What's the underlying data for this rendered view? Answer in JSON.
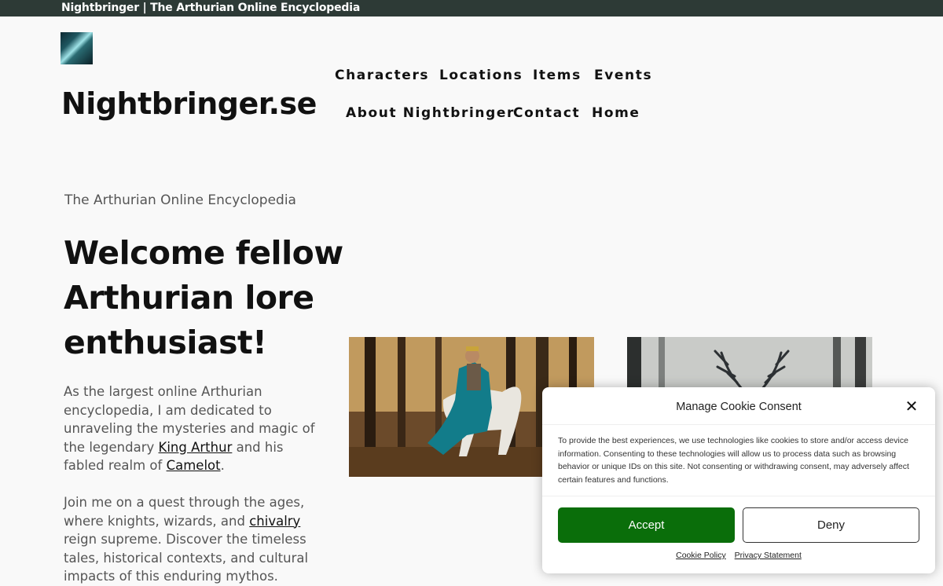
{
  "topbar": {
    "title": "Nightbringer | The Arthurian Online Encyclopedia"
  },
  "header": {
    "logo_icon": "forest-logo-icon",
    "site_title": "Nightbringer.se"
  },
  "nav": {
    "items": [
      {
        "label": "Characters"
      },
      {
        "label": "Locations"
      },
      {
        "label": "Items"
      },
      {
        "label": "Events"
      },
      {
        "label": "About Nightbringer"
      },
      {
        "label": "Contact"
      },
      {
        "label": "Home"
      }
    ]
  },
  "main": {
    "tagline": "The Arthurian Online Encyclopedia",
    "heading": "Welcome fellow Arthurian lore enthusiast!",
    "para1": {
      "before": "As the largest online Arthurian encyclopedia, I am dedicated to unraveling the mysteries and magic of the legendary ",
      "link1": "King Arthur",
      "middle": " and his fabled realm of ",
      "link2": "Camelot",
      "after": "."
    },
    "para2": {
      "before": "Join me on a quest through the ages, where knights, wizards, and ",
      "link": "chivalry",
      "after": " reign supreme. Discover the timeless tales, historical contexts, and cultural impacts of this enduring mythos."
    },
    "images": [
      {
        "name": "knight-on-horse-image"
      },
      {
        "name": "deer-antlers-forest-image"
      }
    ]
  },
  "cookie": {
    "title": "Manage Cookie Consent",
    "close_icon": "close-icon",
    "message": "To provide the best experiences, we use technologies like cookies to store and/or access device information. Consenting to these technologies will allow us to process data such as browsing behavior or unique IDs on this site. Not consenting or withdrawing consent, may adversely affect certain features and functions.",
    "accept": "Accept",
    "deny": "Deny",
    "cookie_policy": "Cookie Policy",
    "privacy_statement": "Privacy Statement",
    "accept_color": "#0a6e0a"
  }
}
